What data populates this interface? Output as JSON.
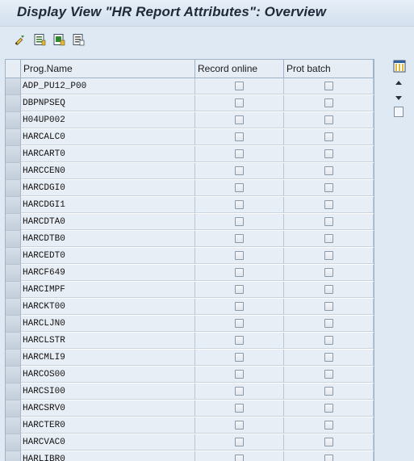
{
  "window": {
    "title": "Display View \"HR Report Attributes\": Overview"
  },
  "toolbar": {
    "icons": [
      "display-change-icon",
      "details-icon",
      "select-all-icon",
      "deselect-all-icon"
    ]
  },
  "table": {
    "columns": [
      "Prog.Name",
      "Record online",
      "Prot batch"
    ],
    "rows": [
      "ADP_PU12_P00",
      "DBPNPSEQ",
      "H04UP002",
      "HARCALC0",
      "HARCART0",
      "HARCCEN0",
      "HARCDGI0",
      "HARCDGI1",
      "HARCDTA0",
      "HARCDTB0",
      "HARCEDT0",
      "HARCF649",
      "HARCIMPF",
      "HARCKT00",
      "HARCLJN0",
      "HARCLSTR",
      "HARCMLI9",
      "HARCOS00",
      "HARCSI00",
      "HARCSRV0",
      "HARCTER0",
      "HARCVAC0",
      "HARLIBR0"
    ],
    "record_online_checked": false,
    "prot_batch_checked": false
  },
  "colors": {
    "background": "#dfe9f4",
    "title_text": "#1e2a38",
    "cell_background": "#e8eef6"
  }
}
